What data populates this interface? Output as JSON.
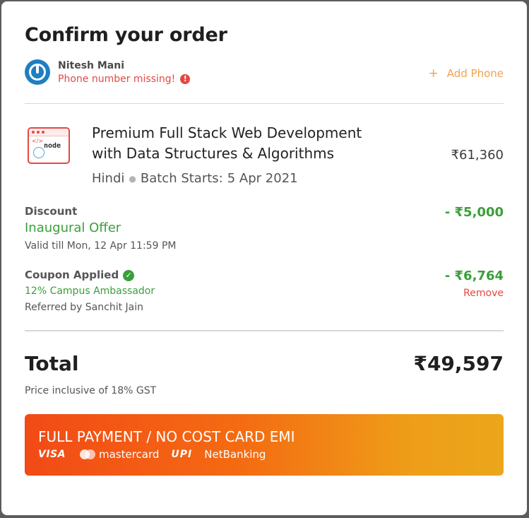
{
  "header": {
    "title": "Confirm your order"
  },
  "user": {
    "name": "Nitesh Mani",
    "phone_warning": "Phone number missing!",
    "warning_icon": "!",
    "add_phone_plus": "+",
    "add_phone_label": "Add Phone"
  },
  "course": {
    "title_line1": "Premium Full Stack Web Development",
    "title_line2": "with Data Structures & Algorithms",
    "price": "₹61,360",
    "language": "Hindi",
    "separator": "●",
    "batch_label": "Batch Starts:",
    "batch_date": "5 Apr 2021",
    "icon_code": "</>",
    "icon_node": "node"
  },
  "discount": {
    "label": "Discount",
    "offer_name": "Inaugural Offer",
    "validity": "Valid till Mon, 12 Apr 11:59 PM",
    "amount": "- ₹5,000"
  },
  "coupon": {
    "label": "Coupon Applied",
    "check_icon": "✓",
    "name": "12% Campus Ambassador",
    "referral": "Referred by Sanchit Jain",
    "amount": "- ₹6,764",
    "remove_label": "Remove"
  },
  "total": {
    "label": "Total",
    "value": "₹49,597",
    "gst_note": "Price inclusive of 18% GST"
  },
  "payment": {
    "button_label": "FULL PAYMENT / NO COST CARD EMI",
    "visa": "VISA",
    "mastercard": "mastercard",
    "upi": "UPI",
    "netbanking": "NetBanking"
  },
  "colors": {
    "accent_orange": "#f5a04b",
    "error_red": "#e5483f",
    "success_green": "#3a9f3a",
    "button_gradient_start": "#f24a16",
    "button_gradient_end": "#eba61b",
    "avatar_blue": "#1e7fc2"
  },
  "icons": {
    "avatar": "power-icon",
    "warning": "alert-circle-icon",
    "coupon_check": "check-circle-icon",
    "course": "code-window-icon"
  }
}
